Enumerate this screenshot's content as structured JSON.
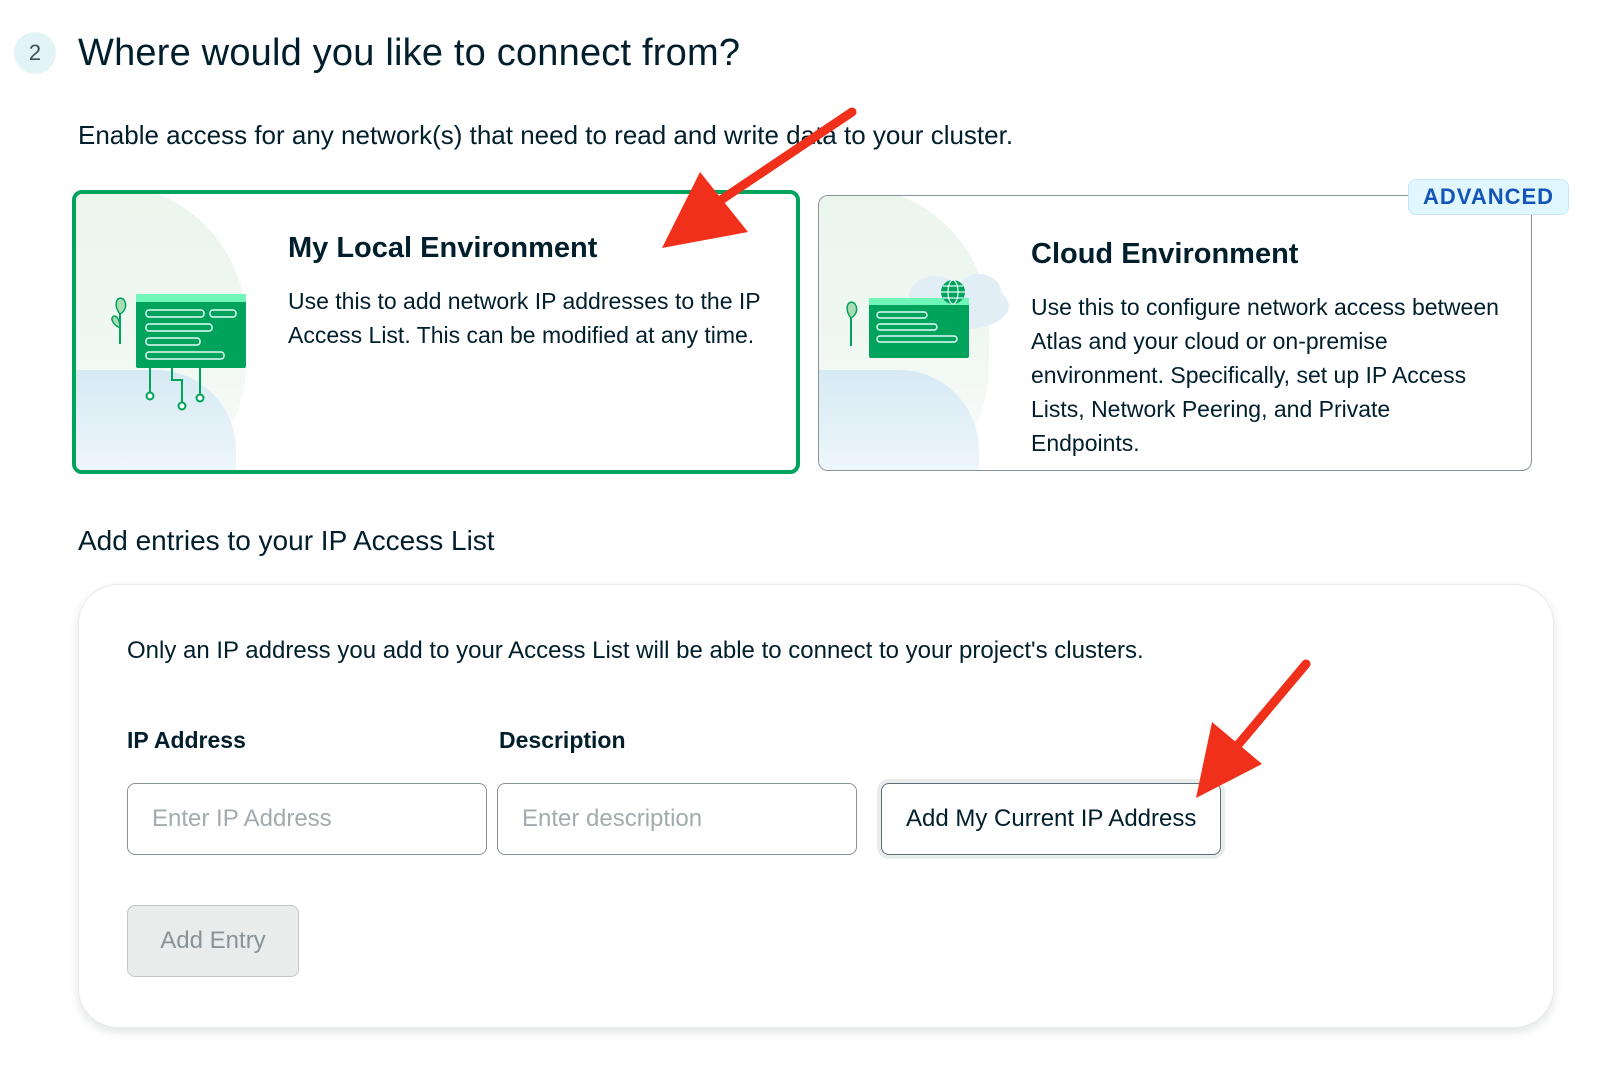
{
  "step": {
    "number": "2",
    "title": "Where would you like to connect from?",
    "intro": "Enable access for any network(s) that need to read and write data to your cluster."
  },
  "environments": {
    "local": {
      "title": "My Local Environment",
      "description": "Use this to add network IP addresses to the IP Access List. This can be modified at any time.",
      "selected": true
    },
    "cloud": {
      "title": "Cloud Environment",
      "description": "Use this to configure network access between Atlas and your cloud or on-premise environment. Specifically, set up IP Access Lists, Network Peering, and Private Endpoints.",
      "badge": "ADVANCED",
      "selected": false
    }
  },
  "access_list": {
    "heading": "Add entries to your IP Access List",
    "note": "Only an IP address you add to your Access List will be able to connect to your project's clusters.",
    "ip_label": "IP Address",
    "ip_value": "",
    "ip_placeholder": "Enter IP Address",
    "description_label": "Description",
    "description_value": "",
    "description_placeholder": "Enter description",
    "current_ip_button": "Add My Current IP Address",
    "add_entry_button": "Add Entry"
  },
  "icons": {
    "local_illustration": "local-network-illustration",
    "cloud_illustration": "cloud-network-illustration",
    "globe": "globe-icon",
    "annotation_arrow": "red-arrow"
  },
  "colors": {
    "selected_border": "#00A35C",
    "badge_text": "#1254B7",
    "annotation": "#F0301A",
    "text": "#001E2B"
  }
}
